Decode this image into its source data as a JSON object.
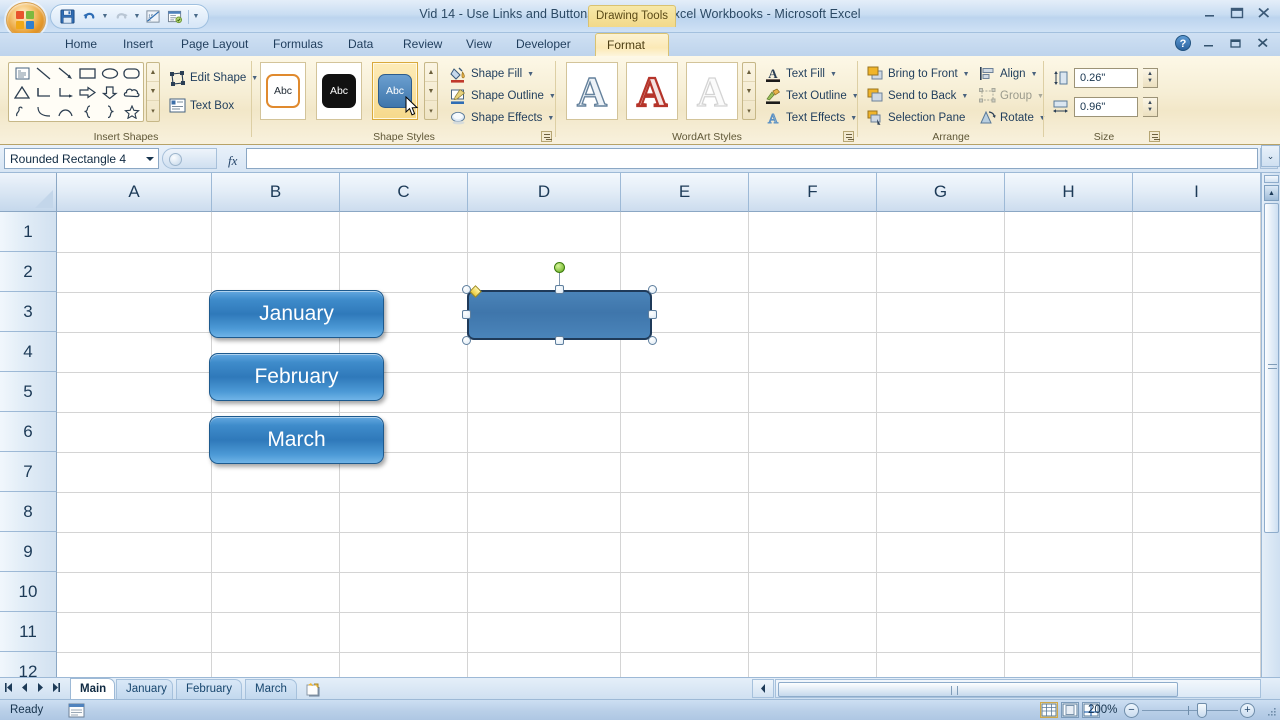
{
  "window": {
    "title": "Vid 14 - Use Links and Buttons to Navigate Excel Workbooks - Microsoft Excel",
    "contextual_tab_label": "Drawing Tools",
    "minimize": "–",
    "maximize": "❐",
    "close": "✕",
    "help": "?"
  },
  "quick_access": {
    "items": [
      {
        "name": "save-icon",
        "label": "Save"
      },
      {
        "name": "undo-icon",
        "label": "Undo"
      },
      {
        "name": "redo-icon",
        "label": "Redo"
      },
      {
        "name": "calculate-icon",
        "label": "Calculate"
      },
      {
        "name": "form-icon",
        "label": "Form"
      },
      {
        "name": "customize-qat-icon",
        "label": "Customize Quick Access Toolbar"
      }
    ]
  },
  "ribbon": {
    "tabs": [
      {
        "label": "Home",
        "active": false
      },
      {
        "label": "Insert",
        "active": false
      },
      {
        "label": "Page Layout",
        "active": false
      },
      {
        "label": "Formulas",
        "active": false
      },
      {
        "label": "Data",
        "active": false
      },
      {
        "label": "Review",
        "active": false
      },
      {
        "label": "View",
        "active": false
      },
      {
        "label": "Developer",
        "active": false
      },
      {
        "label": "Format",
        "active": true
      }
    ],
    "groups": [
      {
        "name": "insert-shapes",
        "title": "Insert Shapes",
        "commands": [
          {
            "label": "Edit Shape",
            "has_caret": true,
            "enabled": true
          },
          {
            "label": "Text Box",
            "has_caret": false,
            "enabled": true
          }
        ]
      },
      {
        "name": "shape-styles",
        "title": "Shape Styles",
        "thumbs": [
          {
            "label": "Abc",
            "style": "outline-orange",
            "selected": false
          },
          {
            "label": "Abc",
            "style": "fill-black",
            "selected": false
          },
          {
            "label": "Abc",
            "style": "fill-blue",
            "selected": true
          }
        ],
        "commands": [
          {
            "label": "Shape Fill",
            "has_caret": true,
            "enabled": true
          },
          {
            "label": "Shape Outline",
            "has_caret": true,
            "enabled": true
          },
          {
            "label": "Shape Effects",
            "has_caret": true,
            "enabled": true
          }
        ]
      },
      {
        "name": "wordart-styles",
        "title": "WordArt Styles",
        "thumbs": [
          {
            "label": "A",
            "color": "#e8eef5"
          },
          {
            "label": "A",
            "color": "#c0392b"
          },
          {
            "label": "A",
            "color": "#f2f2f2"
          }
        ],
        "commands": [
          {
            "label": "Text Fill",
            "has_caret": true,
            "enabled": true
          },
          {
            "label": "Text Outline",
            "has_caret": true,
            "enabled": true
          },
          {
            "label": "Text Effects",
            "has_caret": true,
            "enabled": true
          }
        ]
      },
      {
        "name": "arrange",
        "title": "Arrange",
        "commands": [
          {
            "label": "Bring to Front",
            "has_caret": true,
            "enabled": true
          },
          {
            "label": "Send to Back",
            "has_caret": true,
            "enabled": true
          },
          {
            "label": "Selection Pane",
            "has_caret": false,
            "enabled": true
          },
          {
            "label": "Align",
            "has_caret": true,
            "enabled": true
          },
          {
            "label": "Group",
            "has_caret": true,
            "enabled": false
          },
          {
            "label": "Rotate",
            "has_caret": true,
            "enabled": true
          }
        ]
      },
      {
        "name": "size",
        "title": "Size",
        "height_value": "0.26\"",
        "width_value": "0.96\"",
        "height_icon": "shape-height-icon",
        "width_icon": "shape-width-icon"
      }
    ]
  },
  "formula_bar": {
    "name_box_value": "Rounded Rectangle 4",
    "fx_label": "fx",
    "formula_value": "",
    "expand_icon": "˅"
  },
  "grid": {
    "columns": [
      "A",
      "B",
      "C",
      "D",
      "E",
      "F",
      "G",
      "H",
      "I"
    ],
    "rows": [
      "1",
      "2",
      "3",
      "4",
      "5",
      "6",
      "7",
      "8",
      "9",
      "10",
      "11",
      "12"
    ],
    "shapes": [
      {
        "name": "january-button",
        "label": "January"
      },
      {
        "name": "february-button",
        "label": "February"
      },
      {
        "name": "march-button",
        "label": "March"
      }
    ],
    "selected_shape": {
      "name": "rounded-rectangle-4",
      "label": ""
    }
  },
  "sheet_tabs": {
    "items": [
      {
        "label": "Main",
        "active": true
      },
      {
        "label": "January",
        "active": false
      },
      {
        "label": "February",
        "active": false
      },
      {
        "label": "March",
        "active": false
      }
    ],
    "insert_tab_name": "insert-worksheet-tab",
    "nav": [
      "first-sheet",
      "prev-sheet",
      "next-sheet",
      "last-sheet"
    ]
  },
  "status_bar": {
    "status": "Ready",
    "zoom_percent": "200%",
    "views": [
      {
        "name": "normal-view-button",
        "active": true
      },
      {
        "name": "page-layout-view-button",
        "active": false
      },
      {
        "name": "page-break-preview-button",
        "active": false
      }
    ],
    "zoom_out": "−",
    "zoom_in": "+"
  },
  "colors": {
    "accent_blue": "#3f8ccb",
    "ribbon_gold": "#f2e7c8",
    "titlebar_blue": "#c9ddf2",
    "selected_shape_fill": "#4a83b8",
    "shape_border": "#1f3a59"
  }
}
